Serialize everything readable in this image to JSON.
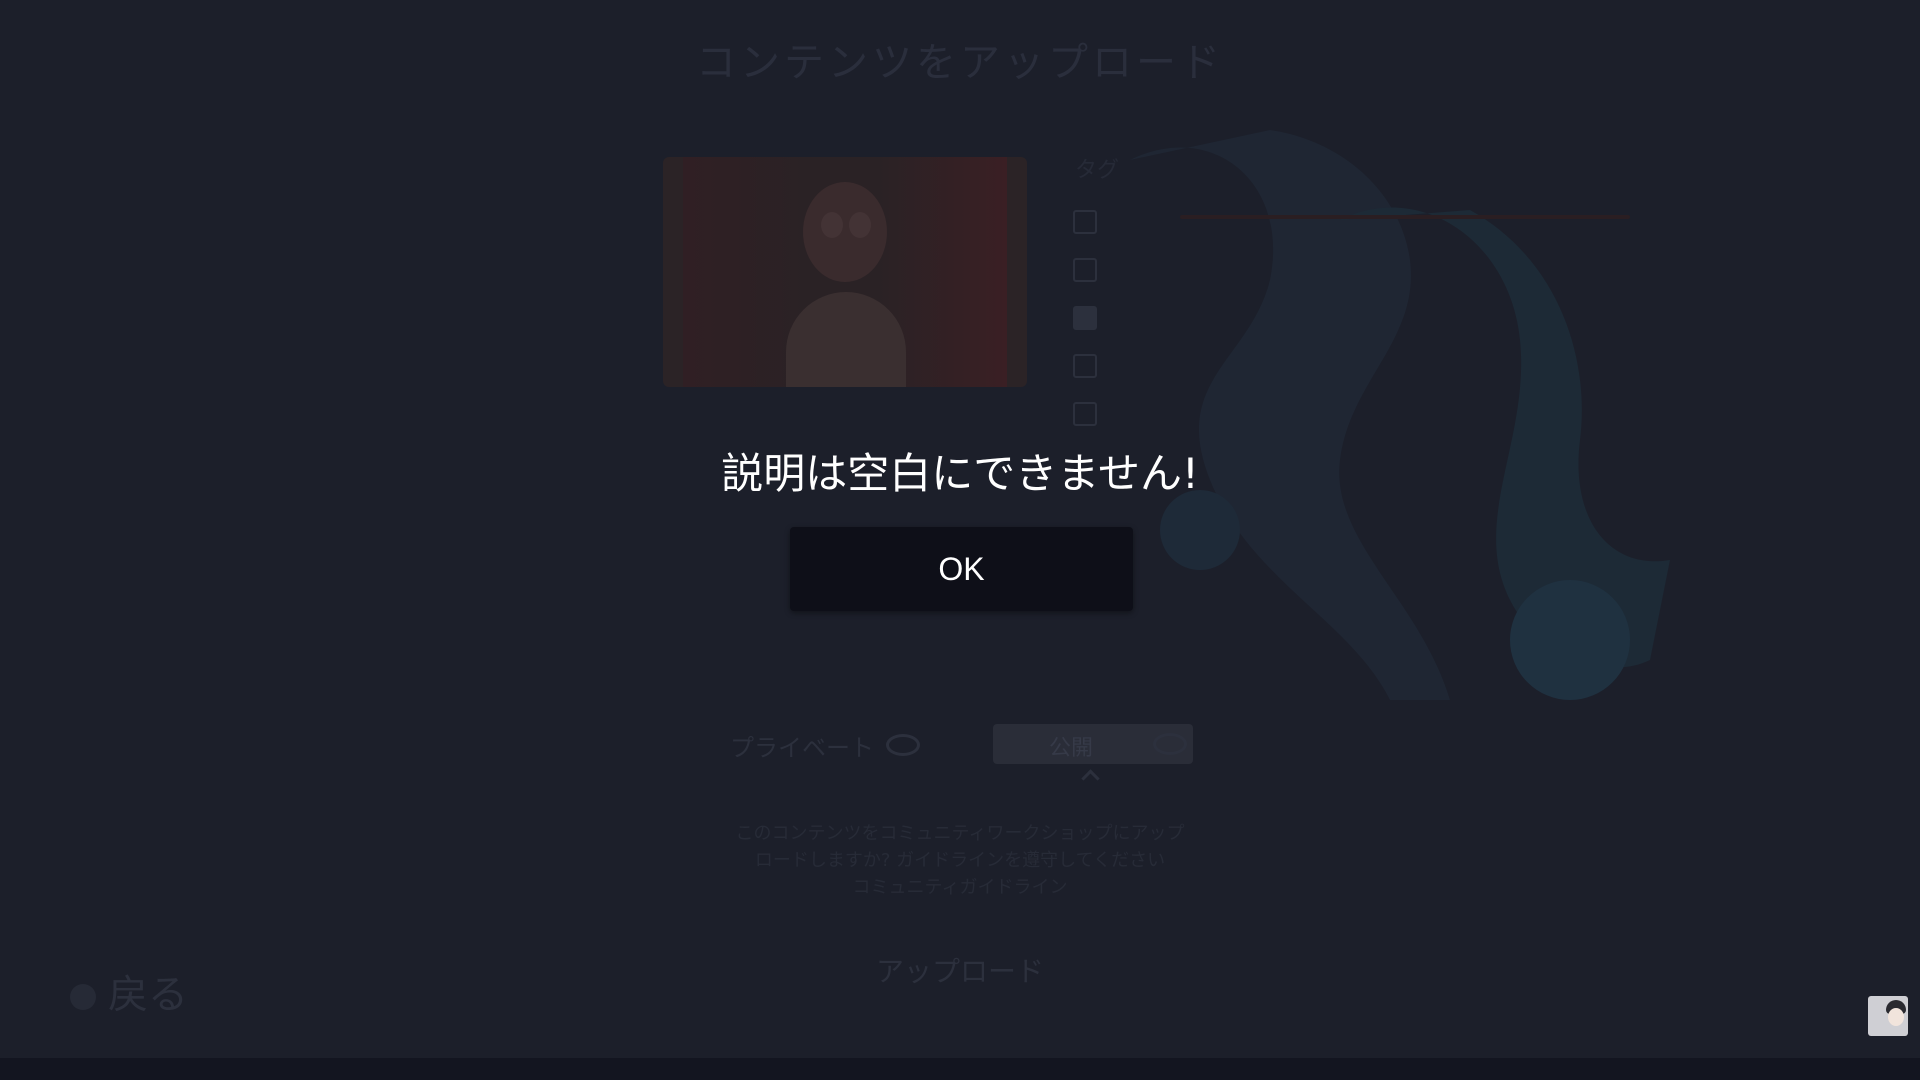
{
  "page": {
    "title": "コンテンツをアップロード"
  },
  "tags": {
    "header": "タグ",
    "items": [
      {
        "label": "",
        "checked": false
      },
      {
        "label": "",
        "checked": false
      },
      {
        "label": "",
        "checked": true
      },
      {
        "label": "",
        "checked": false
      },
      {
        "label": "",
        "checked": false
      }
    ]
  },
  "visibility": {
    "private_label": "プライベート",
    "selected": "公開"
  },
  "notice": {
    "lines": [
      "このコンテンツをコミュニティワークショップにアップ",
      "ロードしますか? ガイドラインを遵守してください",
      "コミュニティガイドライン"
    ]
  },
  "buttons": {
    "upload": "アップロード",
    "back": "戻る"
  },
  "dialog": {
    "message": "説明は空白にできません!",
    "ok": "OK"
  },
  "icons": {
    "visibility": "eye-icon",
    "back": "controller-button-icon",
    "avatar": "user-avatar"
  }
}
